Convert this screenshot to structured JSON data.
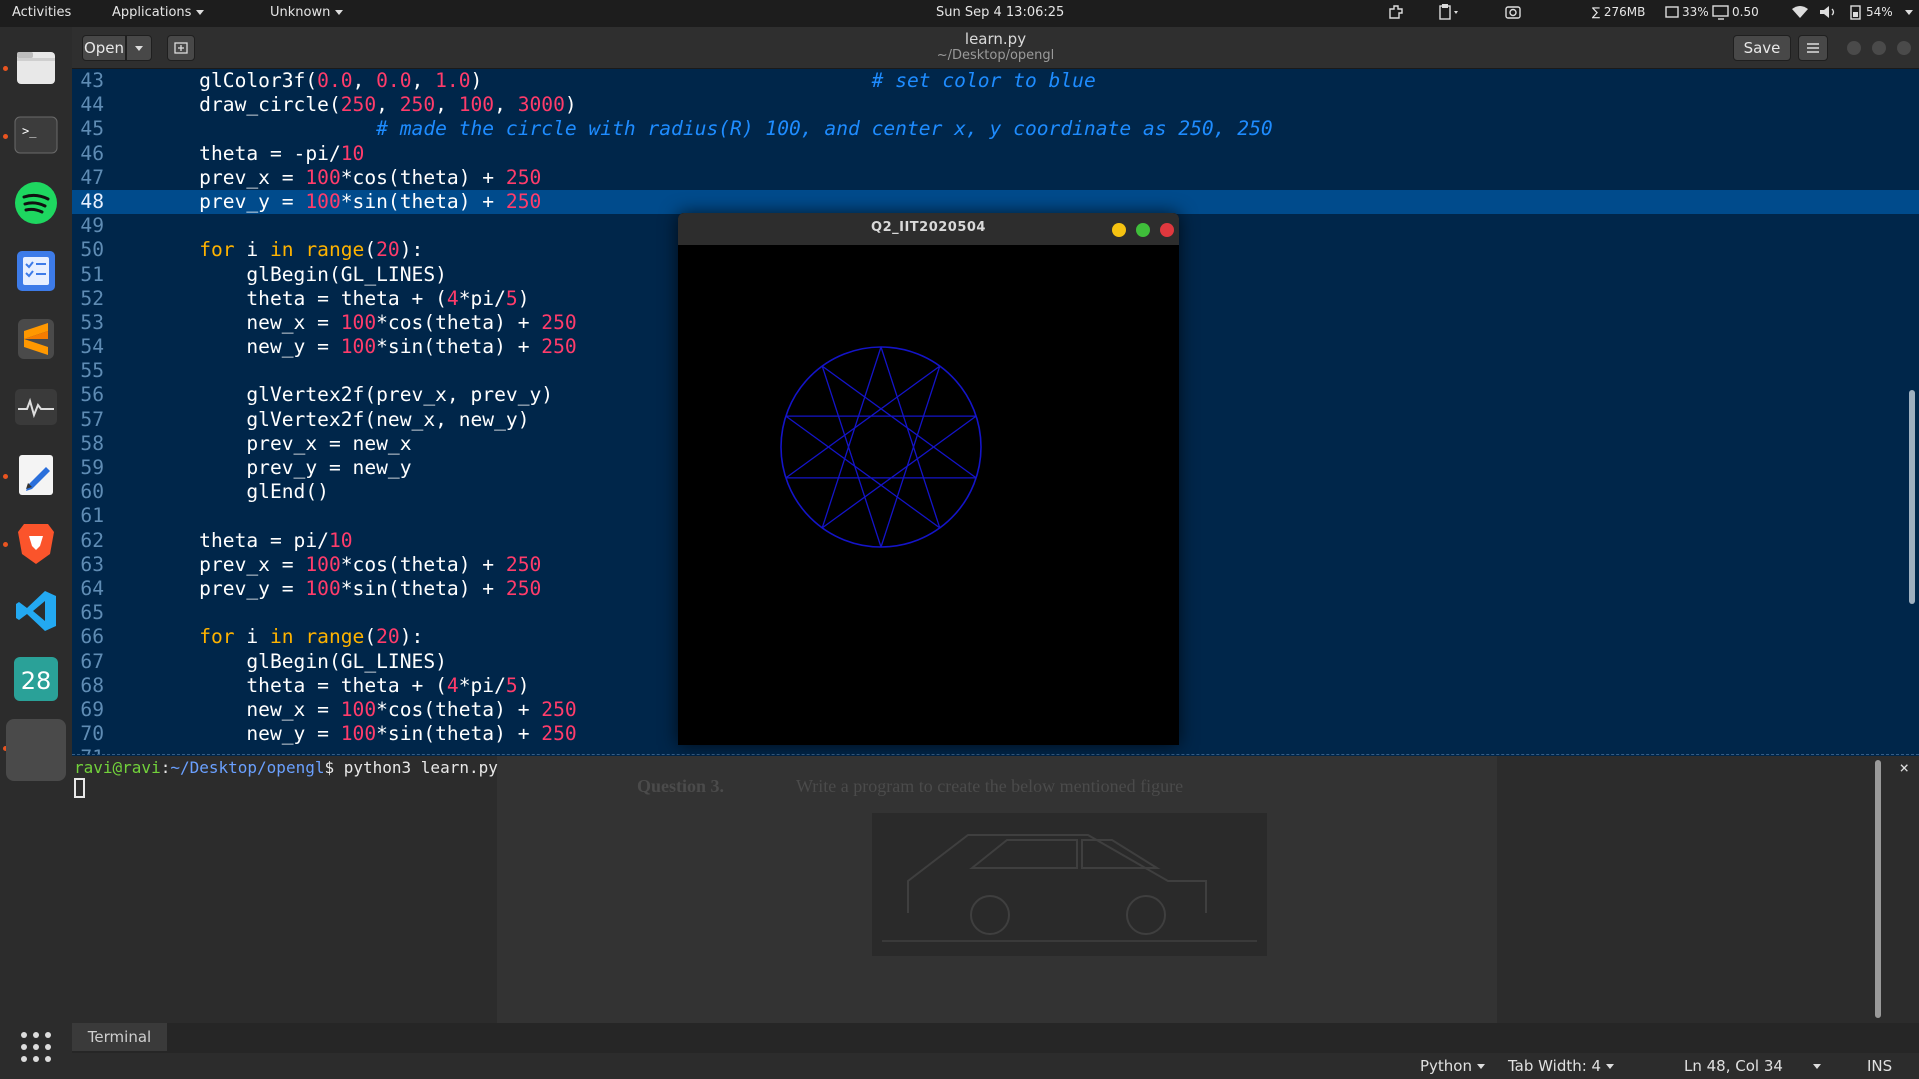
{
  "topbar": {
    "activities": "Activities",
    "applications": "Applications",
    "unknown": "Unknown",
    "clock": "Sun Sep 4  13:06:25",
    "mem": "∑ 276MB",
    "cpu": "33%",
    "load": "0.50",
    "battery": "54%"
  },
  "editor": {
    "open_label": "Open",
    "save_label": "Save",
    "title": "learn.py",
    "path": "~/Desktop/opengl",
    "current_line": 48,
    "lines": [
      {
        "n": "43",
        "segs": [
          [
            "    glColor3f(",
            ""
          ],
          [
            "0.0",
            "num"
          ],
          [
            ", ",
            ""
          ],
          [
            "0.0",
            "num"
          ],
          [
            ", ",
            ""
          ],
          [
            "1.0",
            "num"
          ],
          [
            ")                                 ",
            ""
          ],
          [
            "# set color to blue",
            "cm"
          ]
        ]
      },
      {
        "n": "44",
        "segs": [
          [
            "    draw_circle(",
            ""
          ],
          [
            "250",
            "num"
          ],
          [
            ", ",
            ""
          ],
          [
            "250",
            "num"
          ],
          [
            ", ",
            ""
          ],
          [
            "100",
            "num"
          ],
          [
            ", ",
            ""
          ],
          [
            "3000",
            "num"
          ],
          [
            ")",
            ""
          ]
        ]
      },
      {
        "n": "45",
        "segs": [
          [
            "                   ",
            ""
          ],
          [
            "# made the circle with radius(R) 100, and center x, y coordinate as 250, 250",
            "cm"
          ]
        ]
      },
      {
        "n": "46",
        "segs": [
          [
            "    theta = -pi/",
            ""
          ],
          [
            "10",
            "num"
          ]
        ]
      },
      {
        "n": "47",
        "segs": [
          [
            "    prev_x = ",
            ""
          ],
          [
            "100",
            "num"
          ],
          [
            "*cos(theta) + ",
            ""
          ],
          [
            "250",
            "num"
          ]
        ]
      },
      {
        "n": "48",
        "segs": [
          [
            "    prev_y = ",
            ""
          ],
          [
            "100",
            "num"
          ],
          [
            "*sin(theta) + ",
            ""
          ],
          [
            "250",
            "num"
          ]
        ]
      },
      {
        "n": "49",
        "segs": []
      },
      {
        "n": "50",
        "segs": [
          [
            "    ",
            ""
          ],
          [
            "for",
            "kw"
          ],
          [
            " i ",
            ""
          ],
          [
            "in",
            "kw"
          ],
          [
            " ",
            ""
          ],
          [
            "range",
            "kw"
          ],
          [
            "(",
            ""
          ],
          [
            "20",
            "num"
          ],
          [
            "):",
            ""
          ]
        ]
      },
      {
        "n": "51",
        "segs": [
          [
            "        glBegin(GL_LINES)",
            ""
          ]
        ]
      },
      {
        "n": "52",
        "segs": [
          [
            "        theta = theta + (",
            ""
          ],
          [
            "4",
            "num"
          ],
          [
            "*pi/",
            ""
          ],
          [
            "5",
            "num"
          ],
          [
            ")",
            ""
          ]
        ]
      },
      {
        "n": "53",
        "segs": [
          [
            "        new_x = ",
            ""
          ],
          [
            "100",
            "num"
          ],
          [
            "*cos(theta) + ",
            ""
          ],
          [
            "250",
            "num"
          ]
        ]
      },
      {
        "n": "54",
        "segs": [
          [
            "        new_y = ",
            ""
          ],
          [
            "100",
            "num"
          ],
          [
            "*sin(theta) + ",
            ""
          ],
          [
            "250",
            "num"
          ]
        ]
      },
      {
        "n": "55",
        "segs": []
      },
      {
        "n": "56",
        "segs": [
          [
            "        glVertex2f(prev_x, prev_y)",
            ""
          ]
        ]
      },
      {
        "n": "57",
        "segs": [
          [
            "        glVertex2f(new_x, new_y)",
            ""
          ]
        ]
      },
      {
        "n": "58",
        "segs": [
          [
            "        prev_x = new_x",
            ""
          ]
        ]
      },
      {
        "n": "59",
        "segs": [
          [
            "        prev_y = new_y",
            ""
          ]
        ]
      },
      {
        "n": "60",
        "segs": [
          [
            "        glEnd()",
            ""
          ]
        ]
      },
      {
        "n": "61",
        "segs": []
      },
      {
        "n": "62",
        "segs": [
          [
            "    theta = pi/",
            ""
          ],
          [
            "10",
            "num"
          ]
        ]
      },
      {
        "n": "63",
        "segs": [
          [
            "    prev_x = ",
            ""
          ],
          [
            "100",
            "num"
          ],
          [
            "*cos(theta) + ",
            ""
          ],
          [
            "250",
            "num"
          ]
        ]
      },
      {
        "n": "64",
        "segs": [
          [
            "    prev_y = ",
            ""
          ],
          [
            "100",
            "num"
          ],
          [
            "*sin(theta) + ",
            ""
          ],
          [
            "250",
            "num"
          ]
        ]
      },
      {
        "n": "65",
        "segs": []
      },
      {
        "n": "66",
        "segs": [
          [
            "    ",
            ""
          ],
          [
            "for",
            "kw"
          ],
          [
            " i ",
            ""
          ],
          [
            "in",
            "kw"
          ],
          [
            " ",
            ""
          ],
          [
            "range",
            "kw"
          ],
          [
            "(",
            ""
          ],
          [
            "20",
            "num"
          ],
          [
            "):",
            ""
          ]
        ]
      },
      {
        "n": "67",
        "segs": [
          [
            "        glBegin(GL_LINES)",
            ""
          ]
        ]
      },
      {
        "n": "68",
        "segs": [
          [
            "        theta = theta + (",
            ""
          ],
          [
            "4",
            "num"
          ],
          [
            "*pi/",
            ""
          ],
          [
            "5",
            "num"
          ],
          [
            ")",
            ""
          ]
        ]
      },
      {
        "n": "69",
        "segs": [
          [
            "        new_x = ",
            ""
          ],
          [
            "100",
            "num"
          ],
          [
            "*cos(theta) + ",
            ""
          ],
          [
            "250",
            "num"
          ]
        ]
      },
      {
        "n": "70",
        "segs": [
          [
            "        new_y = ",
            ""
          ],
          [
            "100",
            "num"
          ],
          [
            "*sin(theta) + ",
            ""
          ],
          [
            "250",
            "num"
          ]
        ]
      },
      {
        "n": "71",
        "segs": []
      }
    ]
  },
  "glwindow": {
    "title": "Q2_IIT2020504",
    "figure": {
      "circle_radius": 100,
      "star_points": 10,
      "color": "#1414c8"
    }
  },
  "terminal": {
    "user": "ravi@ravi",
    "sep": ":",
    "path": "~/Desktop/opengl",
    "command": "$ python3 learn.py",
    "tab_label": "Terminal",
    "close_glyph": "×",
    "background_question": "Question 3.",
    "background_text": "Write a program to create the below mentioned figure"
  },
  "statusbar": {
    "language": "Python",
    "tab_width": "Tab Width: 4",
    "position": "Ln 48, Col 34",
    "mode": "INS"
  },
  "colors": {
    "accent": "#e95420",
    "editor_bg": "#00264a",
    "current_line": "#004b8c"
  }
}
